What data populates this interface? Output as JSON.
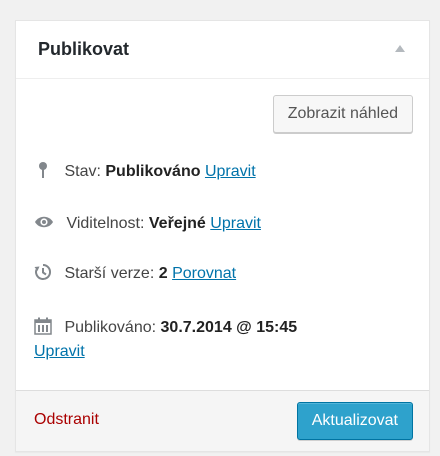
{
  "box": {
    "title": "Publikovat"
  },
  "preview_button": {
    "label": "Zobrazit náhled"
  },
  "status": {
    "label": "Stav:",
    "value": "Publikováno",
    "edit_link": "Upravit",
    "icon": "pin-icon"
  },
  "visibility": {
    "label": "Viditelnost:",
    "value": "Veřejné",
    "edit_link": "Upravit",
    "icon": "eye-icon"
  },
  "revisions": {
    "label": "Starší verze:",
    "value": "2",
    "compare_link": "Porovnat",
    "icon": "history-icon"
  },
  "published": {
    "label": "Publikováno:",
    "value": "30.7.2014 @ 15:45",
    "edit_link": "Upravit",
    "icon": "calendar-icon"
  },
  "footer": {
    "delete_label": "Odstranit",
    "update_label": "Aktualizovat"
  },
  "colors": {
    "link": "#0073aa",
    "delete": "#aa0000",
    "primary_button": "#2ea2cc"
  }
}
